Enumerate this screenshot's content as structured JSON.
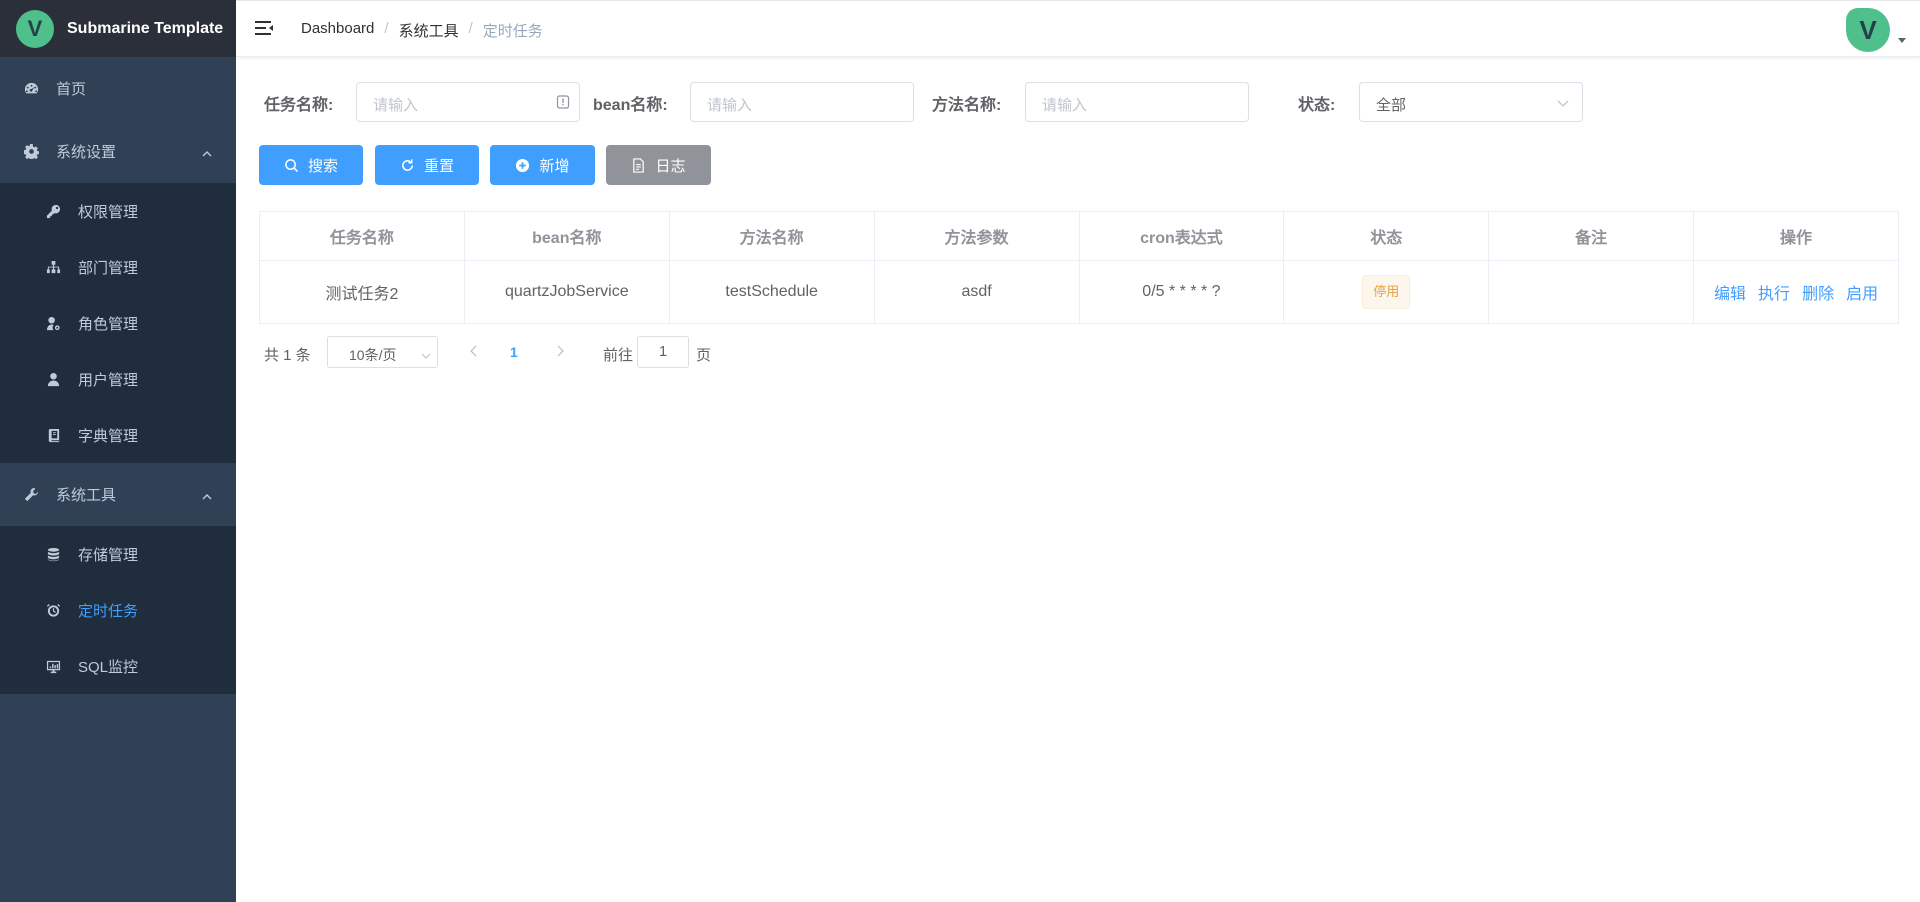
{
  "app": {
    "title": "Submarine Template",
    "logo_letter": "V"
  },
  "sidebar": {
    "home": "首页",
    "group_settings": "系统设置",
    "settings_items": [
      "权限管理",
      "部门管理",
      "角色管理",
      "用户管理",
      "字典管理"
    ],
    "group_tools": "系统工具",
    "tools_items": [
      "存储管理",
      "定时任务",
      "SQL监控"
    ],
    "active_item": "定时任务",
    "bg_color": "#304156",
    "submenu_bg": "#1f2d3d",
    "active_color": "#409eff"
  },
  "navbar": {
    "breadcrumb": [
      "Dashboard",
      "系统工具",
      "定时任务"
    ],
    "avatar_letter": "V"
  },
  "filters": {
    "job_name_label": "任务名称:",
    "job_name_placeholder": "请输入",
    "bean_name_label": "bean名称:",
    "bean_name_placeholder": "请输入",
    "method_name_label": "方法名称:",
    "method_name_placeholder": "请输入",
    "status_label": "状态:",
    "status_value": "全部"
  },
  "buttons": {
    "search": "搜索",
    "reset": "重置",
    "add": "新增",
    "log": "日志",
    "primary_color": "#409eff",
    "info_color": "#909399"
  },
  "table": {
    "columns": [
      "任务名称",
      "bean名称",
      "方法名称",
      "方法参数",
      "cron表达式",
      "状态",
      "备注",
      "操作"
    ],
    "rows": [
      {
        "job_name": "测试任务2",
        "bean_name": "quartzJobService",
        "method_name": "testSchedule",
        "params": "asdf",
        "cron": "0/5 * * * * ?",
        "status": "停用",
        "remark": "",
        "actions": [
          "编辑",
          "执行",
          "删除",
          "启用"
        ]
      }
    ]
  },
  "pagination": {
    "total": "共 1 条",
    "page_size": "10条/页",
    "current_page": "1",
    "goto_label": "前往",
    "goto_value": "1",
    "page_unit": "页"
  }
}
